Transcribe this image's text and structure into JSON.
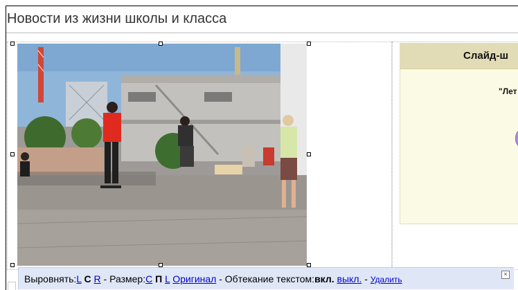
{
  "page": {
    "title": "Новости из жизни школы и класса"
  },
  "slideshow": {
    "header": "Слайд-ш",
    "caption": "\"Лет"
  },
  "image": {
    "alt": "Фотография: подростки катаются на скейтбордах на площади"
  },
  "toolbar": {
    "align_label": "Выровнять:",
    "align_left": "L",
    "align_center": "C",
    "align_right": "R",
    "size_sep": " - Размер:",
    "size_small": "С",
    "size_medium": "П",
    "size_large": "L",
    "original": "Оригинал",
    "wrap_label": " - Обтекание текстом:",
    "wrap_on": "вкл.",
    "wrap_off": "выкл.",
    "delete_sep": " - ",
    "delete": "Удалить",
    "close": "×"
  },
  "colors": {
    "toolbar_bg": "#dfe7f7",
    "link": "#0000cc",
    "slideshow_header_bg": "#e1dcb5",
    "slideshow_bg": "#fbfbe5"
  }
}
